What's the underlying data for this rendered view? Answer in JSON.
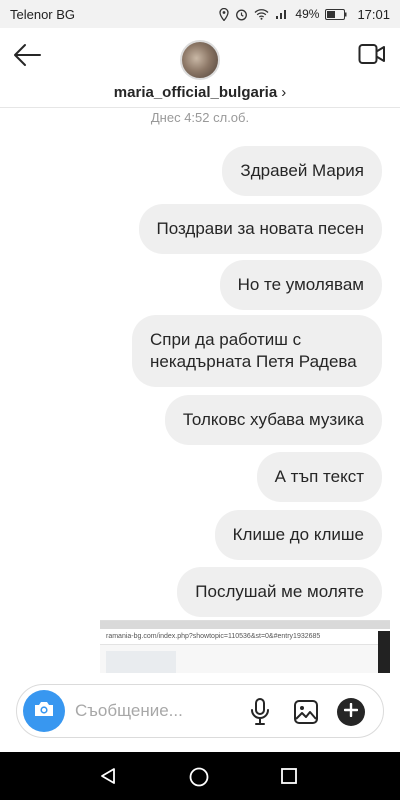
{
  "status_bar": {
    "carrier": "Telenor BG",
    "battery": "49%",
    "time": "17:01"
  },
  "header": {
    "username": "maria_official_bulgaria",
    "chevron": "›"
  },
  "conversation": {
    "timestamp": "Днес 4:52 сл.об.",
    "messages": [
      {
        "text": "Здравей Мария"
      },
      {
        "text": "Поздрави за новата песен"
      },
      {
        "text": "Но те умолявам"
      },
      {
        "text": "Спри да работиш с некадърната Петя Радева"
      },
      {
        "text": "Толковс хубава музика"
      },
      {
        "text": "А тъп текст"
      },
      {
        "text": "Клише до клише"
      },
      {
        "text": "Послушай ме моляте"
      }
    ],
    "shared_image": {
      "url_text": "ramania-bg.com/index.php?showtopic=110536&st=0&#entry1932685"
    }
  },
  "composer": {
    "placeholder": "Съобщение..."
  },
  "icons": {
    "back": "arrow-left-icon",
    "video": "video-camera-icon",
    "camera": "camera-icon",
    "mic": "microphone-icon",
    "gallery": "image-icon",
    "plus": "plus-icon"
  },
  "colors": {
    "accent": "#3897f0",
    "bubble": "#efefef"
  }
}
